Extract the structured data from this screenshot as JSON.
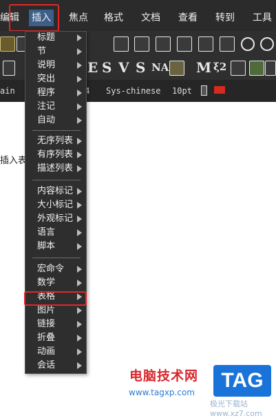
{
  "menubar": {
    "items": [
      "编辑",
      "插入",
      "焦点",
      "格式",
      "文档",
      "查看",
      "转到",
      "工具"
    ]
  },
  "toolbar3": {
    "texts": [
      "ain",
      ".4",
      "Sys-chinese",
      "10pt"
    ]
  },
  "toolbar2": {
    "glyphs": [
      "E",
      "S",
      "V",
      "S",
      "NA",
      "M",
      "ξ2"
    ]
  },
  "insert_menu": {
    "groups": [
      [
        "标题",
        "节",
        "说明",
        "突出",
        "程序",
        "注记",
        "自动"
      ],
      [
        "无序列表",
        "有序列表",
        "描述列表"
      ],
      [
        "内容标记",
        "大小标记",
        "外观标记",
        "语言",
        "脚本"
      ],
      [
        "宏命令",
        "数学",
        "表格",
        "图片",
        "链接",
        "折叠",
        "动画",
        "会话"
      ]
    ],
    "highlighted": "表格"
  },
  "document": {
    "text": "插入表"
  },
  "watermark": {
    "title": "电脑技术网",
    "url": "www.tagxp.com",
    "badge": "TAG",
    "sub": "极光下载站 www.xz7.com"
  },
  "colors": {
    "menubar_bg": "#2b2b2b",
    "menu_bg": "#2e2e2e",
    "highlight_border": "#e3262a",
    "active_menu_bg": "#3c5f8a"
  }
}
